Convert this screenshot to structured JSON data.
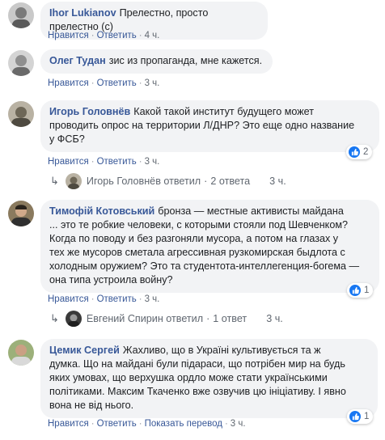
{
  "comments": [
    {
      "author": "Ihor Lukianov",
      "text": "Прелестно, просто прелестно (с)",
      "like": "Нравится",
      "reply": "Ответить",
      "time": "4 ч."
    },
    {
      "author": "Олег Тудан",
      "text": "зис из пропаганда, мне кажется.",
      "like": "Нравится",
      "reply": "Ответить",
      "time": "3 ч."
    },
    {
      "author": "Игорь Головнёв",
      "text_lines": [
        "Какой такой институт будущего может",
        "проводить опрос на территории Л/ДНР? Это еще одно название",
        "у ФСБ?"
      ],
      "like": "Нравится",
      "reply": "Ответить",
      "time": "3 ч.",
      "reactions": "2",
      "replies_summary": {
        "who": "Игорь Головнёв ответил",
        "count": "2 ответа",
        "time": "3 ч."
      }
    },
    {
      "author": "Тимофій Котовський",
      "text_lines": [
        "бронза — местные активисты майдана",
        "... это те робкие человеки, с которыми стояли под Шевченком?",
        "Когда по поводу и без разгоняли мусора, а потом на глазах у",
        "тех же мусоров сметала агрессивная рузкомирская быдлота с",
        "холодным оружием? Это та студентота-интеллегенция-богема —",
        "она типа устроила войну?"
      ],
      "like": "Нравится",
      "reply": "Ответить",
      "time": "3 ч.",
      "reactions": "1",
      "replies_summary": {
        "who": "Евгений Спирин ответил",
        "count": "1 ответ",
        "time": "3 ч."
      }
    },
    {
      "author": "Цемик Сергей",
      "text_lines": [
        "Жахливо, що в Україні культивується та ж",
        "думка. Що на майдані були підараси, що потрібен мир на будь",
        "яких умовах, що верхушка ордло може стати українськими",
        "політиками. Максим Ткаченко вже озвучив цю ініціативу. І явно",
        "вона не від нього."
      ],
      "like": "Нравится",
      "reply": "Ответить",
      "translate": "Показать перевод",
      "time": "3 ч.",
      "reactions": "1"
    }
  ],
  "colors": {
    "link": "#385898",
    "bubble": "#f2f3f5",
    "meta": "#606770",
    "like_blue": "#1877f2"
  }
}
